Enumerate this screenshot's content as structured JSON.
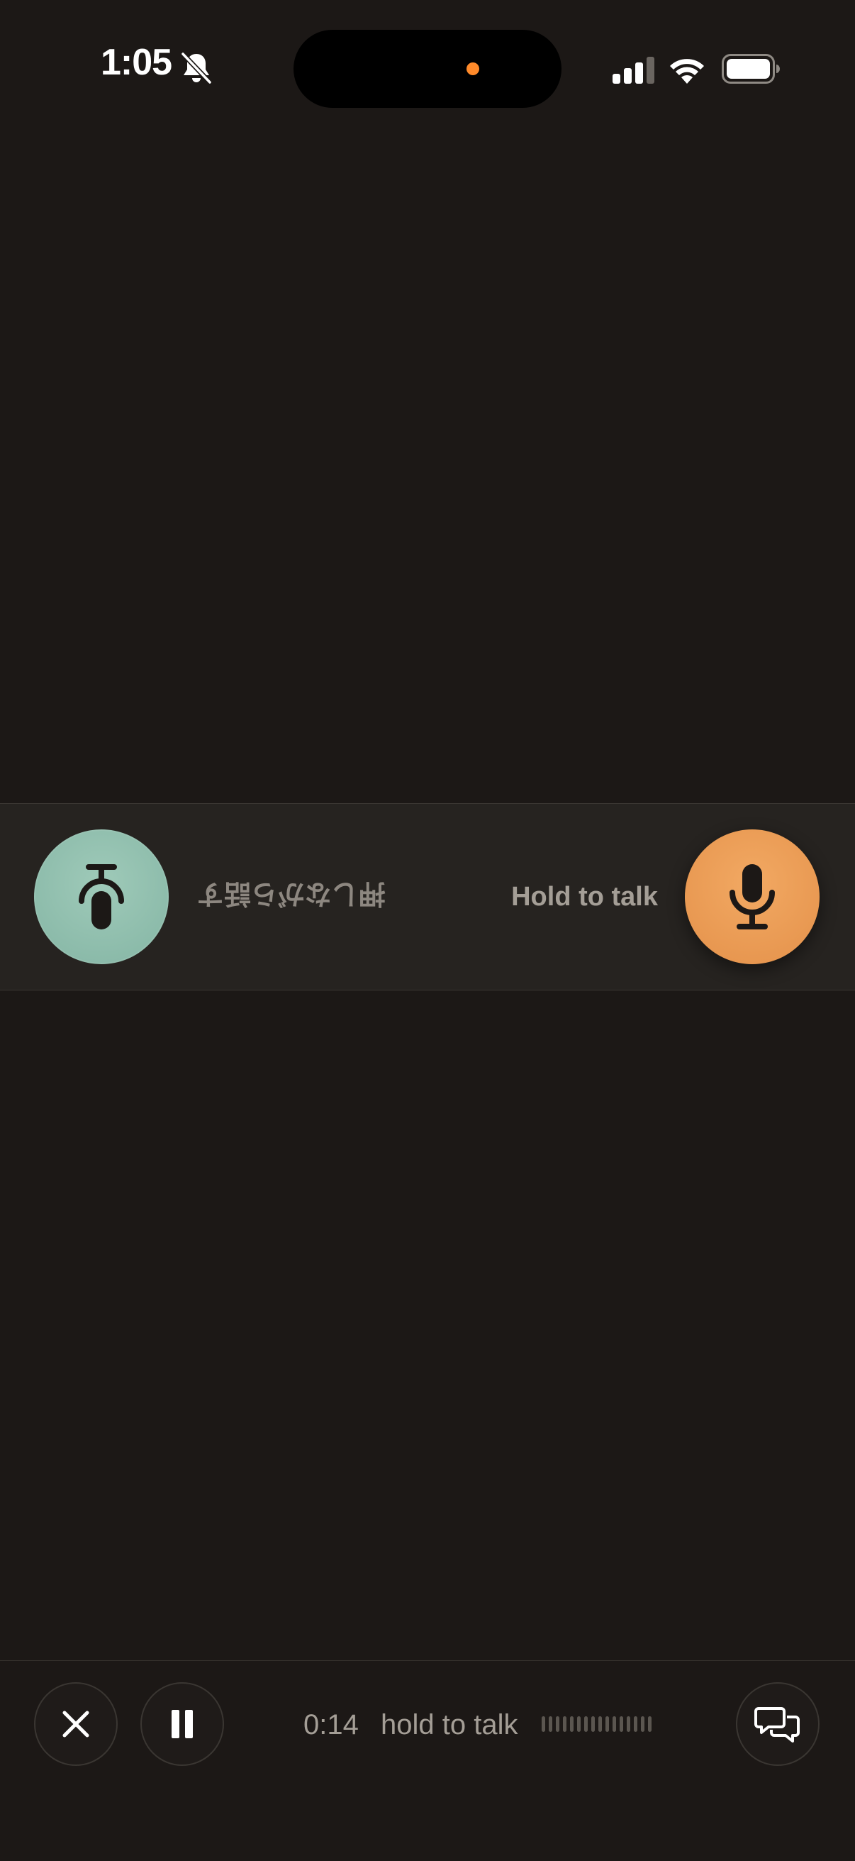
{
  "status_bar": {
    "time": "1:05",
    "silent_icon": "bell-slash-icon",
    "signal_icon": "cellular-signal-icon",
    "wifi_icon": "wifi-icon",
    "battery_icon": "battery-icon",
    "island_dot_color": "#ff8a2a"
  },
  "talk_strip": {
    "left_button_icon": "microphone-icon",
    "left_button_color": "#8fbfae",
    "left_label": "押しながら話す",
    "right_label": "Hold to talk",
    "right_button_icon": "microphone-icon",
    "right_button_color": "#eb9d56"
  },
  "bottom_bar": {
    "close_icon": "close-icon",
    "pause_icon": "pause-icon",
    "timer": "0:14",
    "status": "hold to talk",
    "waveform_icon": "waveform-icon",
    "chat_icon": "chat-bubbles-icon"
  }
}
